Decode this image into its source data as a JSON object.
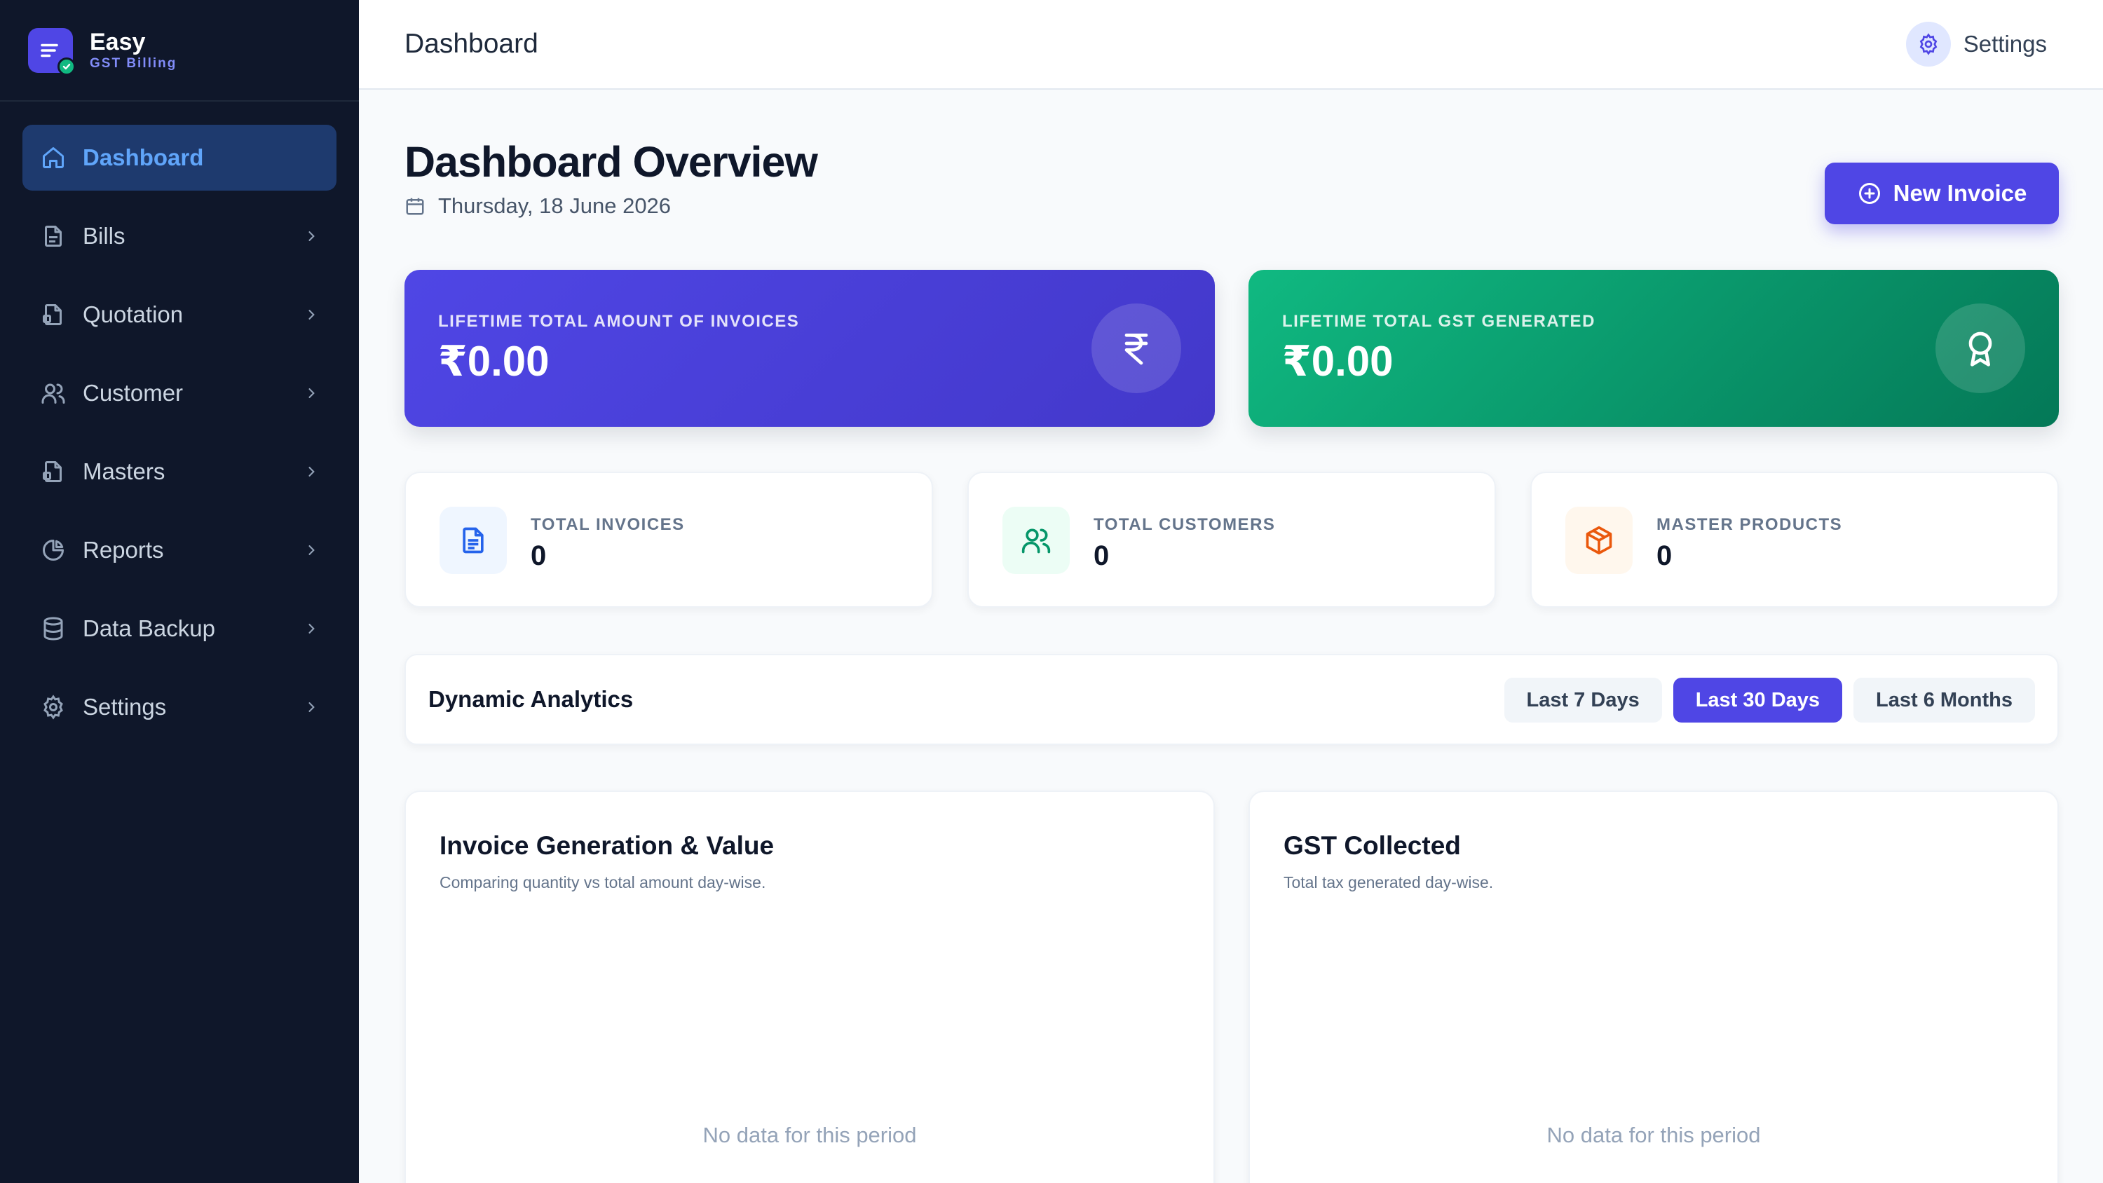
{
  "brand": {
    "name": "Easy",
    "subtitle": "GST Billing",
    "accent": "#4f46e5"
  },
  "sidebar": {
    "items": [
      {
        "label": "Dashboard",
        "icon": "home-icon",
        "active": true
      },
      {
        "label": "Bills",
        "icon": "document-icon"
      },
      {
        "label": "Quotation",
        "icon": "quotation-icon"
      },
      {
        "label": "Customer",
        "icon": "users-icon"
      },
      {
        "label": "Masters",
        "icon": "masters-icon"
      },
      {
        "label": "Reports",
        "icon": "pie-chart-icon"
      },
      {
        "label": "Data Backup",
        "icon": "database-icon"
      },
      {
        "label": "Settings",
        "icon": "gear-icon"
      }
    ]
  },
  "topbar": {
    "title": "Dashboard",
    "settings_label": "Settings"
  },
  "overview": {
    "title": "Dashboard Overview",
    "date": "Thursday, 18 June 2026",
    "new_invoice_label": "New Invoice"
  },
  "hero": {
    "invoices": {
      "label": "LIFETIME TOTAL AMOUNT OF INVOICES",
      "value": "₹0.00",
      "icon": "rupee-icon",
      "color": "#4f46e5"
    },
    "gst": {
      "label": "LIFETIME TOTAL GST GENERATED",
      "value": "₹0.00",
      "icon": "award-icon",
      "color": "#059669"
    }
  },
  "stats": [
    {
      "label": "TOTAL INVOICES",
      "value": "0",
      "icon": "file-text-icon",
      "color": "#2563eb"
    },
    {
      "label": "TOTAL CUSTOMERS",
      "value": "0",
      "icon": "users-icon",
      "color": "#059669"
    },
    {
      "label": "MASTER PRODUCTS",
      "value": "0",
      "icon": "box-icon",
      "color": "#ea580c"
    }
  ],
  "analytics": {
    "title": "Dynamic Analytics",
    "ranges": [
      "Last 7 Days",
      "Last 30 Days",
      "Last 6 Months"
    ],
    "selected": "Last 30 Days"
  },
  "charts": [
    {
      "title": "Invoice Generation & Value",
      "subtitle": "Comparing quantity vs total amount day-wise.",
      "empty": "No data for this period"
    },
    {
      "title": "GST Collected",
      "subtitle": "Total tax generated day-wise.",
      "empty": "No data for this period"
    }
  ]
}
